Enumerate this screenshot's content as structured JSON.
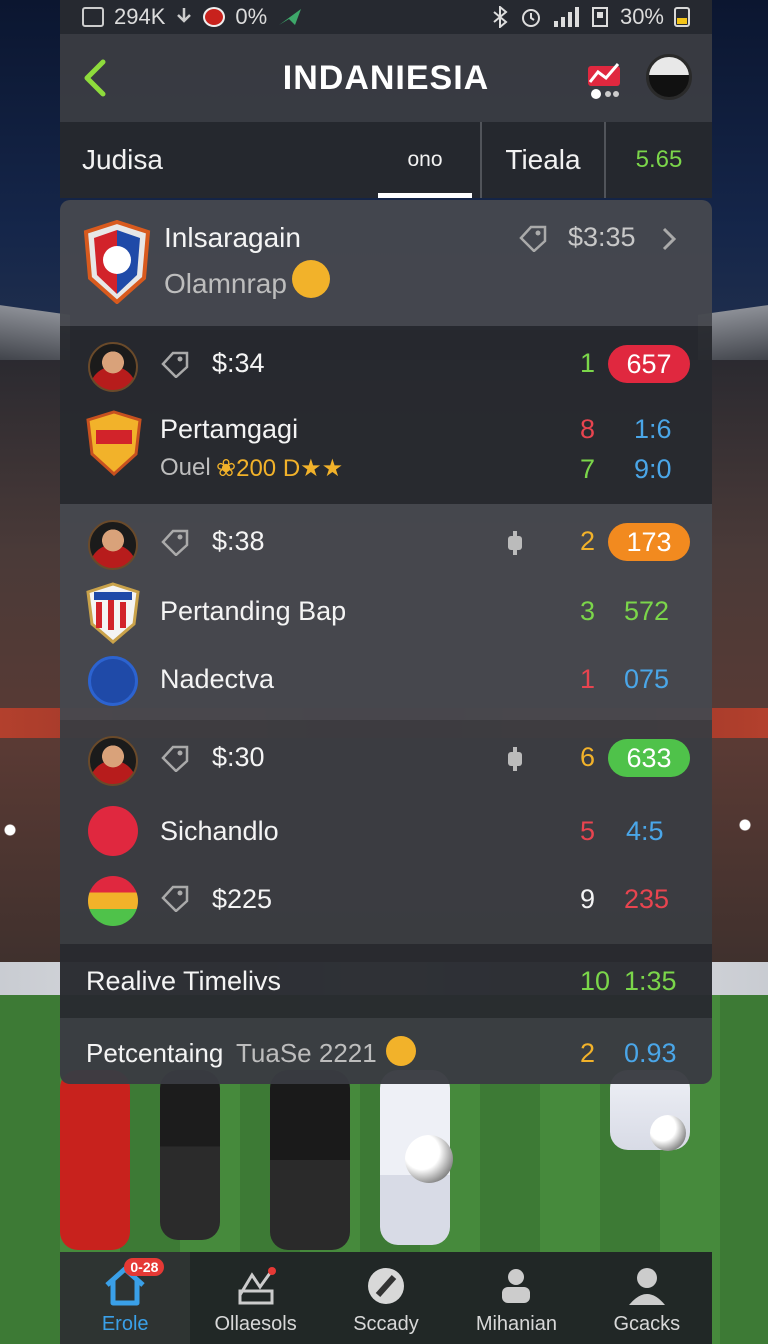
{
  "status_bar": {
    "left_text": "294K",
    "signal_pct": "0%",
    "battery": "30%"
  },
  "header": {
    "title": "INDANIESIA",
    "back_icon": "chevron-left-icon"
  },
  "tabs": [
    {
      "label": "Judisa"
    },
    {
      "label": "ono",
      "active": true
    },
    {
      "label": "Tieala"
    },
    {
      "label": "5.65"
    }
  ],
  "featured": {
    "team": "Inlsaragain",
    "subtitle": "Olamnrap",
    "time": "$3:35"
  },
  "matches": [
    {
      "time": "$:34",
      "rank": "1",
      "pill": "657",
      "pill_color": "#e0283f",
      "rows": [
        {
          "team": "Pertamgagi",
          "left": "8",
          "right": "1:6",
          "left_color": "#e8444f",
          "right_color": "#4aa6e8"
        },
        {
          "team": "Ouel",
          "extra": "❀200 D★★",
          "left": "7",
          "right": "9:0",
          "left_color": "#7bd64a",
          "right_color": "#4aa6e8"
        }
      ]
    },
    {
      "time": "$:38",
      "rank": "2",
      "pill": "173",
      "pill_color": "#f28a1f",
      "rows": [
        {
          "team": "Pertanding Bap",
          "left": "3",
          "right": "572",
          "left_color": "#7bd64a",
          "right_color": "#7bd64a"
        },
        {
          "team": "Nadectva",
          "left": "1",
          "right": "075",
          "left_color": "#e8444f",
          "right_color": "#4aa6e8"
        }
      ]
    },
    {
      "time": "$:30",
      "rank": "6",
      "pill": "633",
      "pill_color": "#4fc24a",
      "rows": [
        {
          "team": "Sichandlo",
          "left": "5",
          "right": "4:5",
          "left_color": "#e8444f",
          "right_color": "#4aa6e8"
        },
        {
          "team": "$225",
          "left": "9",
          "right": "235",
          "left_color": "#f4f4f4",
          "right_color": "#e8444f"
        }
      ]
    }
  ],
  "summary": [
    {
      "label": "Realive Timelivs",
      "left": "10",
      "right": "1:35"
    },
    {
      "label": "Petcentaing",
      "label2": "TuaSe 2221",
      "left": "2",
      "right": "0.93"
    }
  ],
  "bottom_nav": [
    {
      "label": "Erole",
      "icon": "home-icon",
      "badge": "0-28",
      "active": true
    },
    {
      "label": "Ollaesols",
      "icon": "tactics-icon"
    },
    {
      "label": "Sccady",
      "icon": "compass-icon"
    },
    {
      "label": "Mihanian",
      "icon": "team-icon"
    },
    {
      "label": "Gcacks",
      "icon": "profile-icon"
    }
  ],
  "colors": {
    "accent_green": "#7bd64a",
    "accent_blue": "#4aa6e8",
    "accent_red": "#e8444f",
    "accent_yellow": "#f2b22a"
  }
}
